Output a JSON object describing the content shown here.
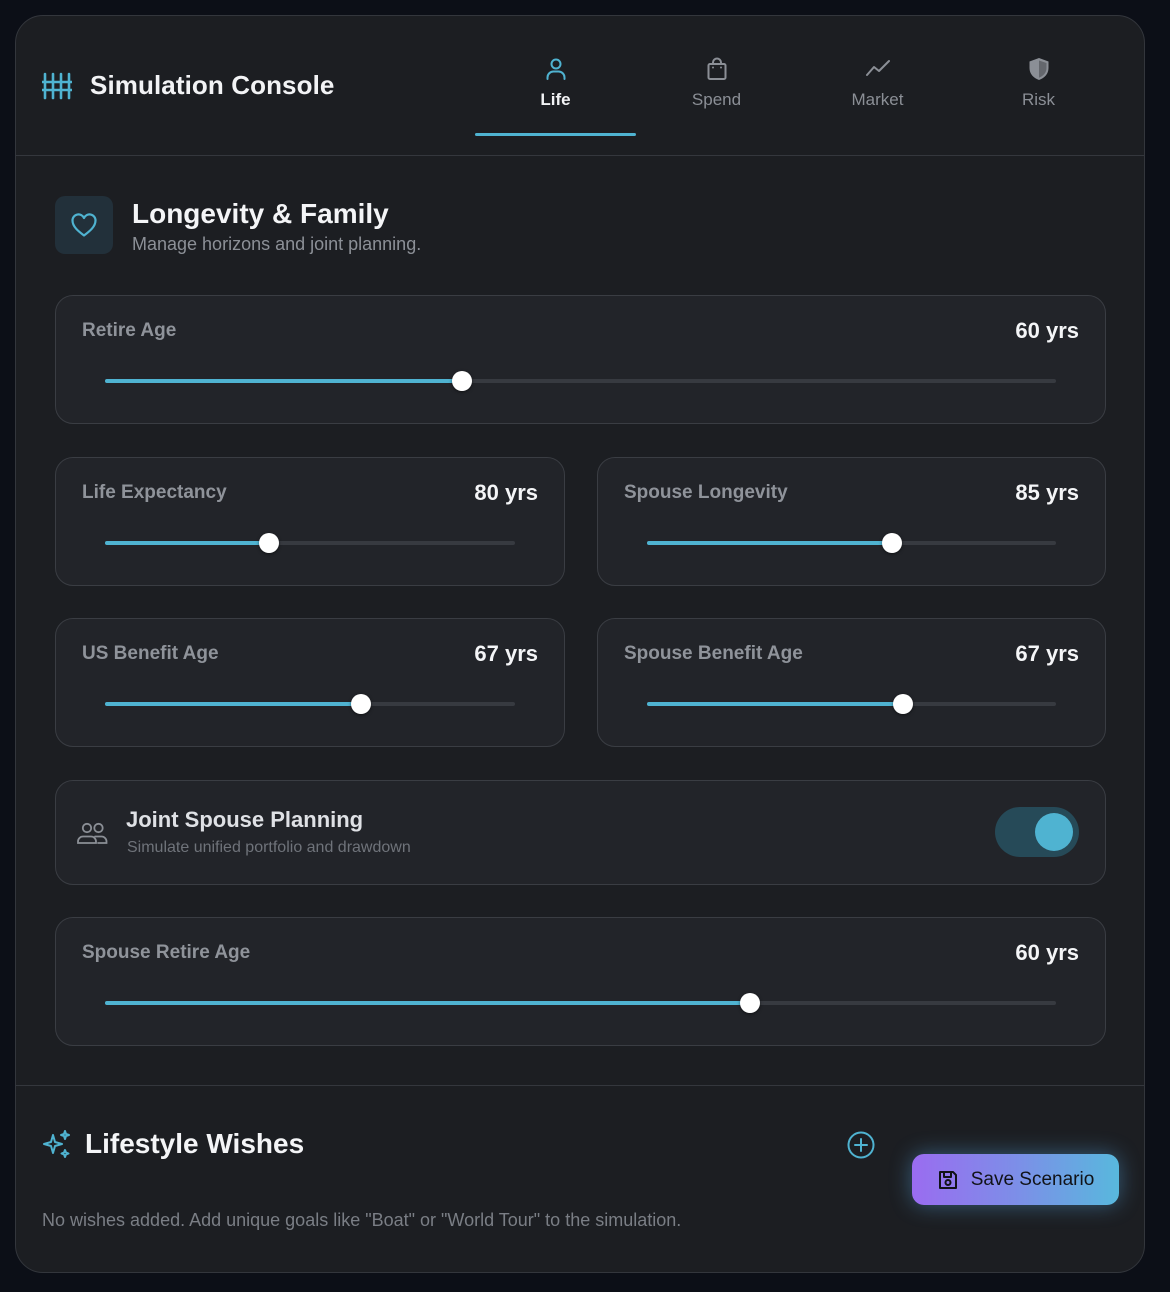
{
  "app": {
    "title": "Simulation Console",
    "accent_color": "#4fb3d1",
    "brand_icon": "sliders-icon"
  },
  "tabs": [
    {
      "label": "Life",
      "icon": "person-icon",
      "active": true
    },
    {
      "label": "Spend",
      "icon": "shopping-bag-icon",
      "active": false
    },
    {
      "label": "Market",
      "icon": "trend-line-icon",
      "active": false
    },
    {
      "label": "Risk",
      "icon": "shield-icon",
      "active": false
    }
  ],
  "section": {
    "title": "Longevity & Family",
    "subtitle": "Manage horizons and joint planning.",
    "icon": "heart-icon"
  },
  "sliders": {
    "retire_age": {
      "label": "Retire Age",
      "value": "60 yrs",
      "fill_percent": 37.5
    },
    "life_expectancy": {
      "label": "Life Expectancy",
      "value": "80 yrs",
      "fill_percent": 40
    },
    "spouse_longevity": {
      "label": "Spouse Longevity",
      "value": "85 yrs",
      "fill_percent": 60
    },
    "us_benefit_age": {
      "label": "US Benefit Age",
      "value": "67 yrs",
      "fill_percent": 62.5
    },
    "spouse_benefit_age": {
      "label": "Spouse Benefit Age",
      "value": "67 yrs",
      "fill_percent": 62.5
    },
    "spouse_retire_age": {
      "label": "Spouse Retire Age",
      "value": "60 yrs",
      "fill_percent": 67.8
    }
  },
  "joint": {
    "title": "Joint Spouse Planning",
    "subtitle": "Simulate unified portfolio and drawdown",
    "enabled": true,
    "icon": "people-icon"
  },
  "wishes": {
    "title": "Lifestyle Wishes",
    "empty_text": "No wishes added. Add unique goals like \"Boat\" or \"World Tour\" to the simulation.",
    "icon": "sparkle-icon",
    "add_icon": "plus-circle-icon"
  },
  "save": {
    "label": "Save Scenario",
    "icon": "floppy-disk-icon"
  }
}
